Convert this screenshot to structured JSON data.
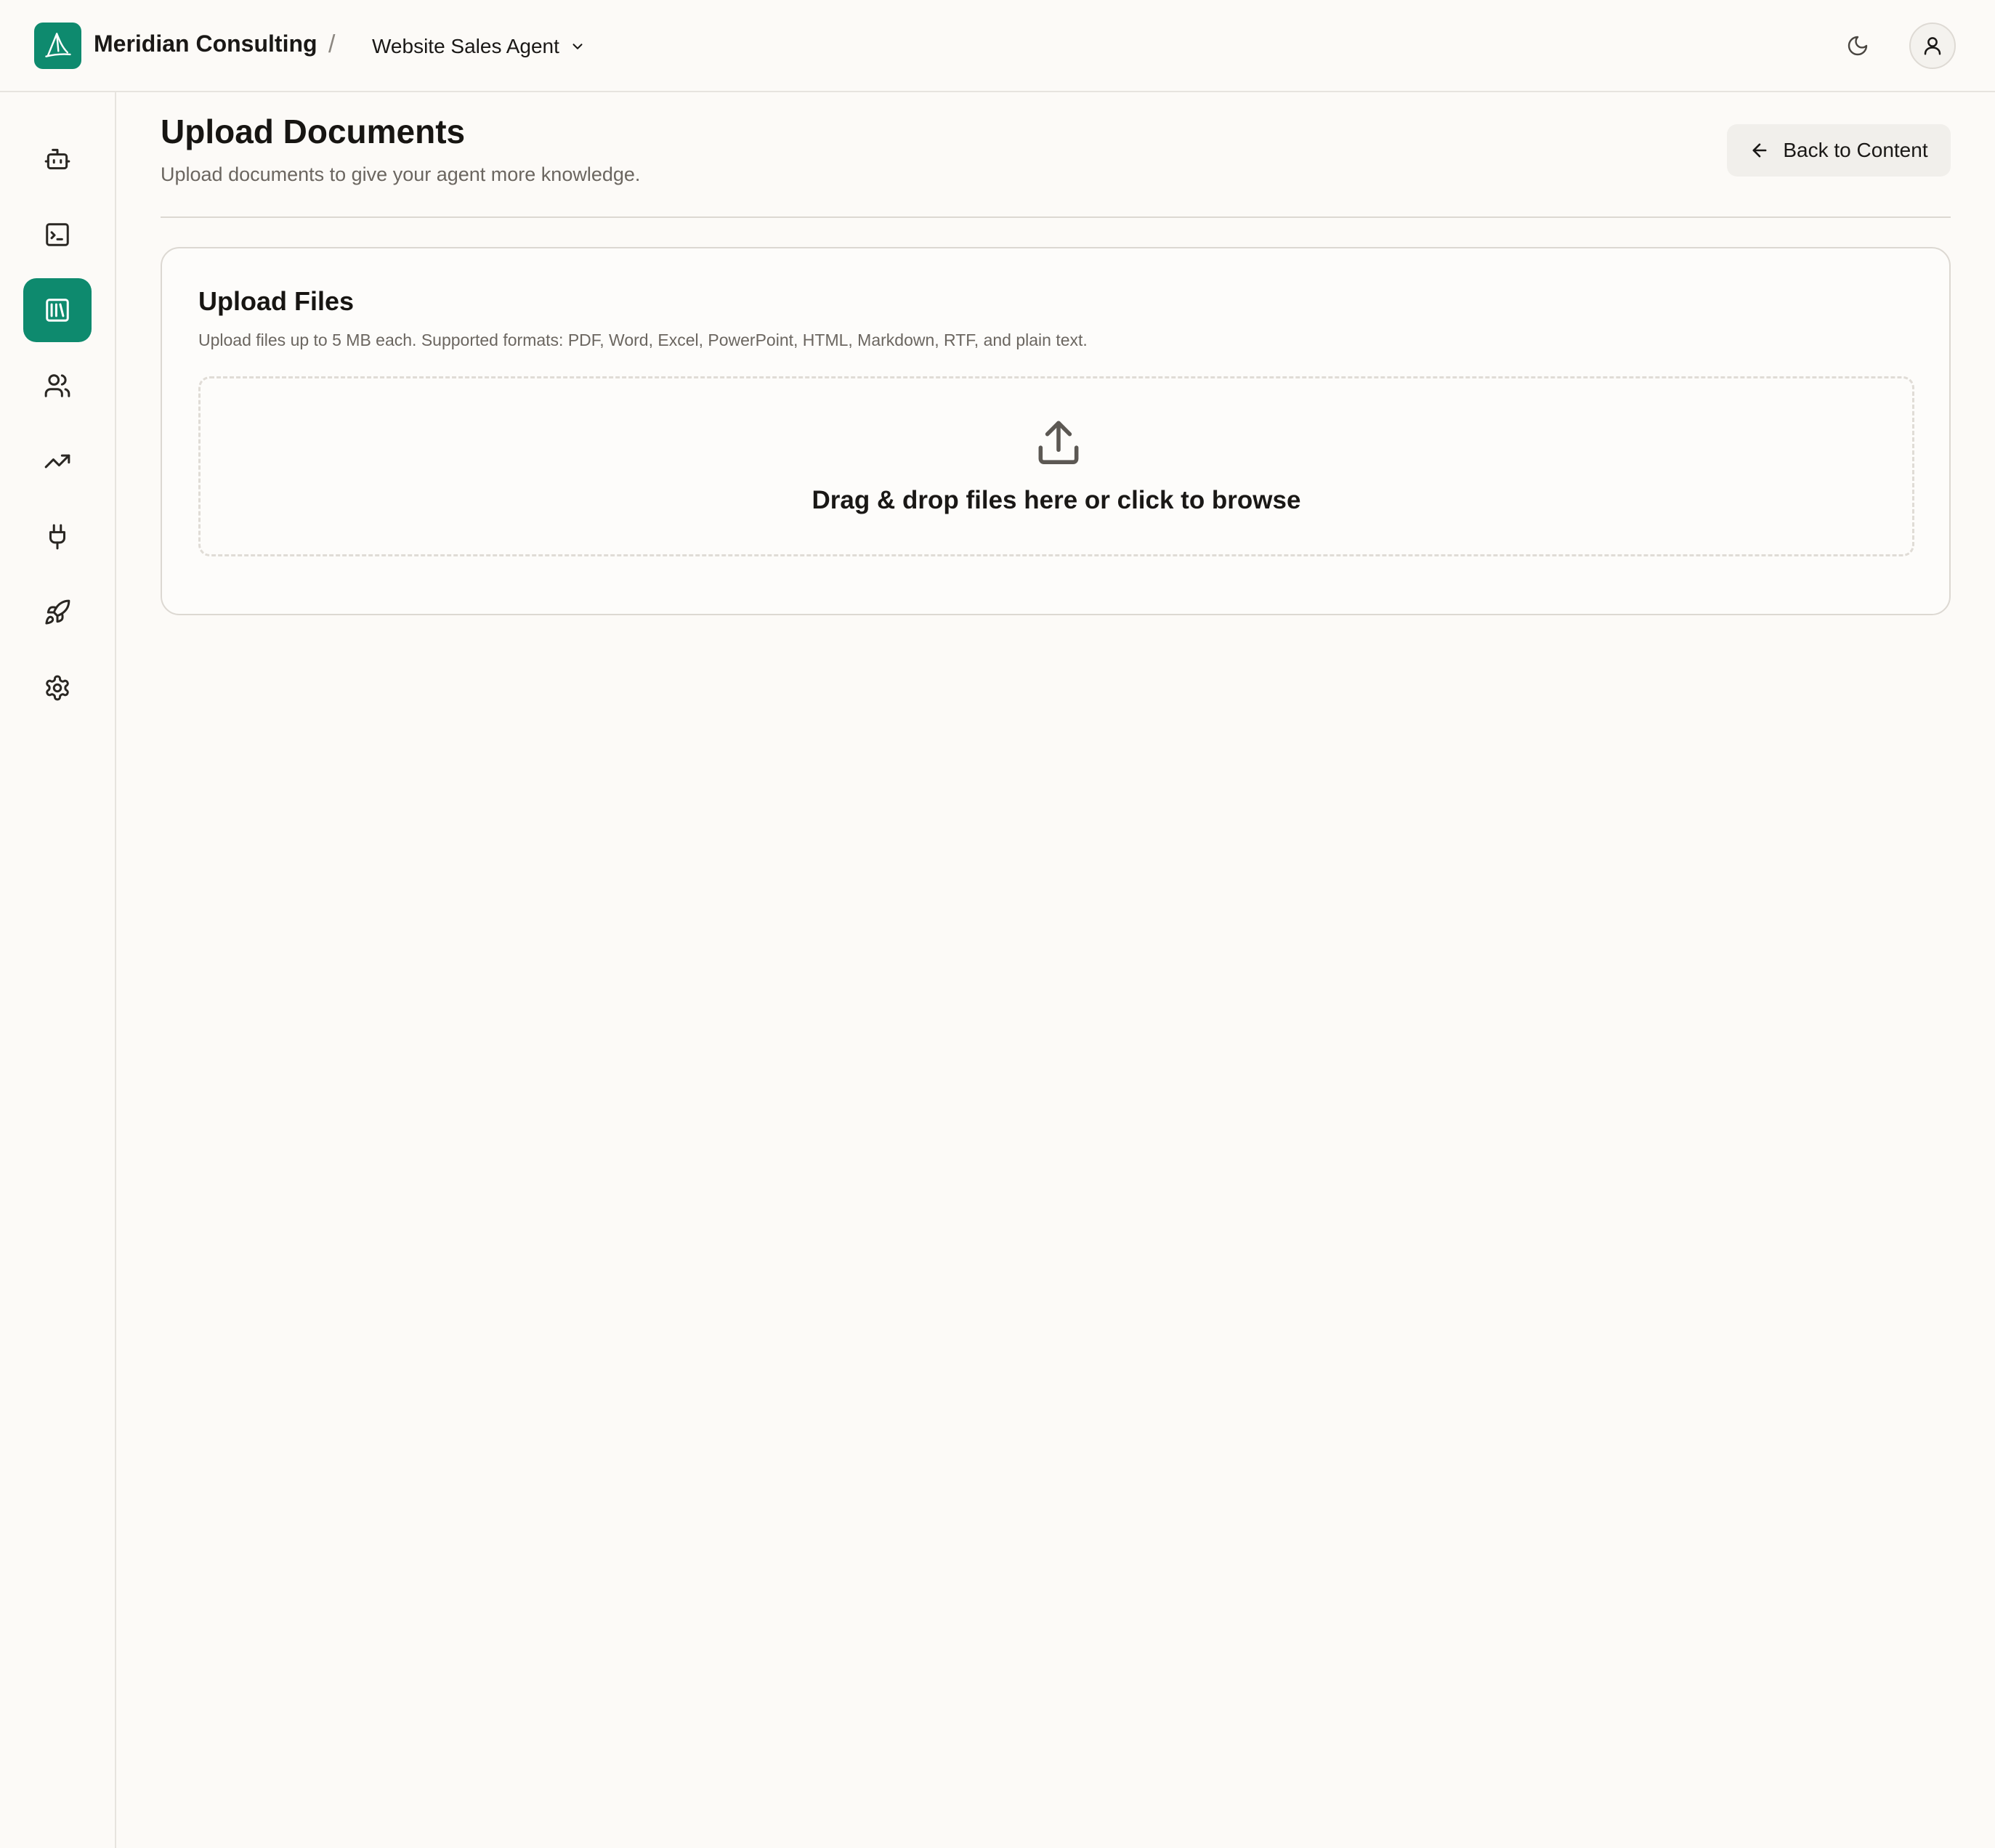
{
  "header": {
    "org_name": "Meridian Consulting",
    "separator": "/",
    "agent_name": "Website Sales Agent",
    "logo_icon": "sailboat-icon",
    "theme_icon": "moon-icon",
    "user_icon": "user-icon"
  },
  "sidebar": {
    "items": [
      {
        "icon": "bot-icon",
        "active": false
      },
      {
        "icon": "terminal-icon",
        "active": false
      },
      {
        "icon": "library-icon",
        "active": true
      },
      {
        "icon": "users-icon",
        "active": false
      },
      {
        "icon": "trending-up-icon",
        "active": false
      },
      {
        "icon": "plug-icon",
        "active": false
      },
      {
        "icon": "rocket-icon",
        "active": false
      },
      {
        "icon": "settings-icon",
        "active": false
      }
    ]
  },
  "main": {
    "title": "Upload Documents",
    "subtitle": "Upload documents to give your agent more knowledge.",
    "back_label": "Back to Content",
    "card": {
      "title": "Upload Files",
      "description": "Upload files up to 5 MB each. Supported formats: PDF, Word, Excel, PowerPoint, HTML, Markdown, RTF, and plain text.",
      "dropzone_text": "Drag & drop files here or click to browse"
    }
  },
  "colors": {
    "accent": "#0e8a6e",
    "background": "#fcfaf7",
    "border": "#dcd8d2",
    "muted_text": "#6b6660"
  }
}
